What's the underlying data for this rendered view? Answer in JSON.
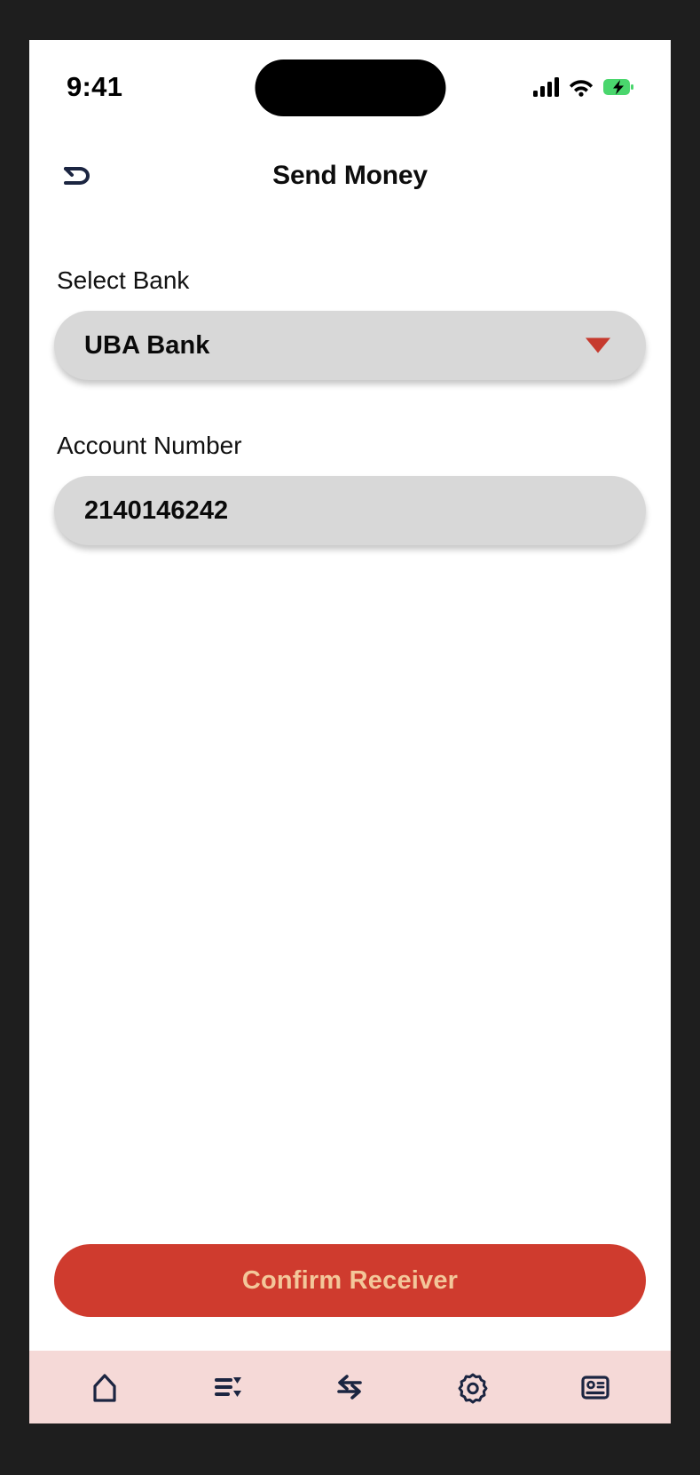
{
  "status_bar": {
    "time": "9:41",
    "signal_icon": "cellular-signal-icon",
    "wifi_icon": "wifi-icon",
    "battery_icon": "battery-charging-icon",
    "battery_color": "#4ad66d"
  },
  "header": {
    "title": "Send Money",
    "back_icon": "back-arrow-icon"
  },
  "form": {
    "bank": {
      "label": "Select Bank",
      "value": "UBA Bank",
      "caret_icon": "chevron-down-icon",
      "caret_color": "#c63a2e"
    },
    "account": {
      "label": "Account Number",
      "value": "2140146242",
      "placeholder": "Account Number"
    }
  },
  "cta": {
    "label": "Confirm Receiver",
    "background": "#cf3b2e",
    "text_color": "#f3c79a"
  },
  "bottom_nav": {
    "background": "#f5d9d7",
    "icon_color": "#1b2541",
    "items": [
      {
        "name": "home-icon",
        "label": "Home"
      },
      {
        "name": "transactions-list-icon",
        "label": "Transactions"
      },
      {
        "name": "transfer-arrows-icon",
        "label": "Transfer"
      },
      {
        "name": "settings-gear-icon",
        "label": "Settings"
      },
      {
        "name": "id-card-icon",
        "label": "Account"
      }
    ]
  }
}
